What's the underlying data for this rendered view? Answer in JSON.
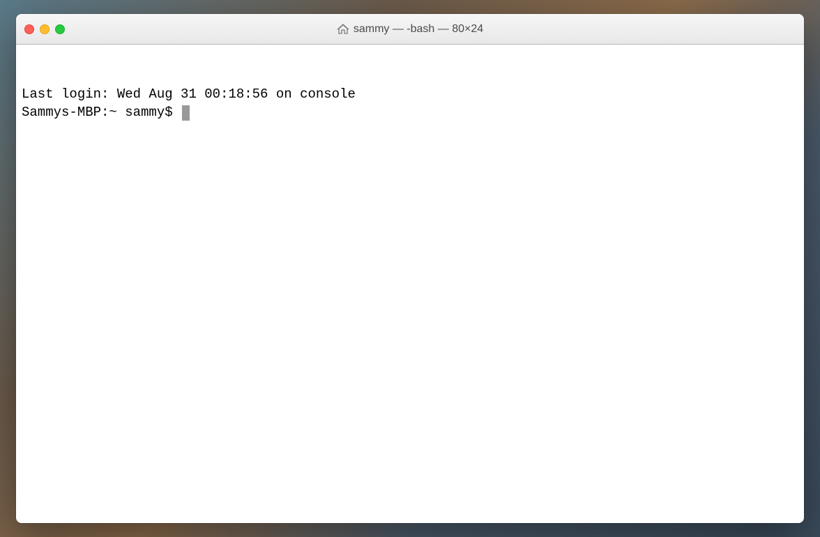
{
  "window": {
    "title": "sammy — -bash — 80×24"
  },
  "terminal": {
    "last_login_line": "Last login: Wed Aug 31 00:18:56 on console",
    "prompt": "Sammys-MBP:~ sammy$ "
  }
}
